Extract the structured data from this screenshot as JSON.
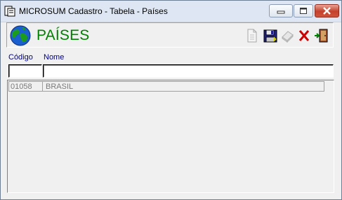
{
  "window": {
    "title": "MICROSUM Cadastro - Tabela - Países",
    "controls": [
      "minimize",
      "maximize",
      "close"
    ]
  },
  "header": {
    "title": "PAÍSES",
    "icon": "globe-icon",
    "tools": [
      {
        "name": "new-record",
        "icon": "document-icon",
        "enabled": false
      },
      {
        "name": "save",
        "icon": "floppy-disk-icon",
        "enabled": true
      },
      {
        "name": "delete",
        "icon": "eraser-icon",
        "enabled": false
      },
      {
        "name": "cancel",
        "icon": "red-x-icon",
        "enabled": true
      },
      {
        "name": "exit",
        "icon": "exit-door-icon",
        "enabled": true
      }
    ]
  },
  "columns": [
    "Código",
    "Nome"
  ],
  "filters": {
    "codigo": "",
    "nome": ""
  },
  "rows": [
    {
      "codigo": "01058",
      "nome": "BRASIL"
    }
  ],
  "colors": {
    "title_green": "#008000",
    "header_blue": "#000080",
    "red_x": "#cc0000"
  }
}
